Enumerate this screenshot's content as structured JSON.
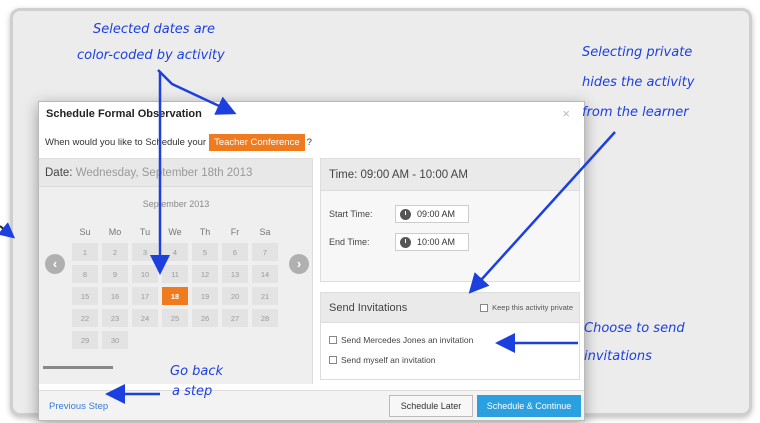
{
  "dialog": {
    "title": "Schedule Formal Observation",
    "close": "×",
    "question_prefix": "When would you like to Schedule your",
    "activity": "Teacher Conference",
    "question_suffix": "?"
  },
  "date_panel": {
    "label": "Date:",
    "value": "Wednesday, September 18th 2013",
    "month": "September 2013",
    "weekdays": [
      "Su",
      "Mo",
      "Tu",
      "We",
      "Th",
      "Fr",
      "Sa"
    ],
    "weeks": [
      [
        "1",
        "2",
        "3",
        "4",
        "5",
        "6",
        "7"
      ],
      [
        "8",
        "9",
        "10",
        "11",
        "12",
        "13",
        "14"
      ],
      [
        "15",
        "16",
        "17",
        "18",
        "19",
        "20",
        "21"
      ],
      [
        "22",
        "23",
        "24",
        "25",
        "26",
        "27",
        "28"
      ],
      [
        "29",
        "30"
      ]
    ],
    "selected_day": "18",
    "prev_arrow": "‹",
    "next_arrow": "›"
  },
  "time_panel": {
    "header": "Time: 09:00 AM - 10:00 AM",
    "start_label": "Start Time:",
    "start_value": "09:00 AM",
    "end_label": "End Time:",
    "end_value": "10:00 AM"
  },
  "invitations": {
    "header": "Send Invitations",
    "private_label": "Keep this activity private",
    "private_checked": false,
    "option_1": "Send Mercedes Jones an invitation",
    "option_2": "Send myself an invitation"
  },
  "footer": {
    "previous": "Previous Step",
    "later": "Schedule Later",
    "continue": "Schedule & Continue"
  },
  "annotations": {
    "colors": {
      "line1": "Selected dates are",
      "line2": "color-coded by activity"
    },
    "private": {
      "line1": "Selecting private",
      "line2": "hides the activity",
      "line3": "from the learner"
    },
    "invite": {
      "line1": "Choose to send",
      "line2": "invitations"
    },
    "back": {
      "line1": "Go back",
      "line2": "a step"
    }
  },
  "theme": {
    "accent": "#f07a1e",
    "primary": "#2aa0e0",
    "annotation": "#1c3fe0"
  }
}
